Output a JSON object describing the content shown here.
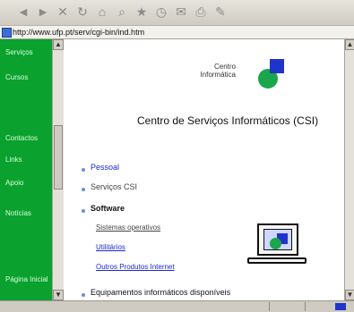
{
  "toolbar": {
    "icons": [
      "back-icon",
      "forward-icon",
      "stop-icon",
      "refresh-icon",
      "home-icon",
      "search-icon",
      "favorites-icon",
      "history-icon",
      "mail-icon",
      "print-icon",
      "edit-icon"
    ]
  },
  "address": {
    "text": "http://www.ufp.pt/serv/cgi-bin/ind.htm"
  },
  "sidebar": {
    "items": [
      "Serviços",
      "Cursos",
      "",
      "Contactos",
      "Links",
      "Apoio",
      "Notícias",
      "Página Inicial"
    ]
  },
  "main": {
    "logo_text": "Centro\nInformática",
    "title": "Centro de Serviços Informáticos (CSI)",
    "items": [
      {
        "label": "Pessoal",
        "color": "#1b2ad0"
      },
      {
        "label": "Serviços CSI",
        "color": "#444444"
      },
      {
        "label": "Software",
        "color": "#111111"
      }
    ],
    "subitems": [
      {
        "label": "Sistemas operativos",
        "color": "#444444"
      },
      {
        "label": "Utilitários",
        "color": "#1b2ad0"
      },
      {
        "label": "Outros Produtos Internet",
        "color": "#1b2ad0"
      }
    ],
    "bottom_item": "Equipamentos informáticos disponíveis"
  }
}
